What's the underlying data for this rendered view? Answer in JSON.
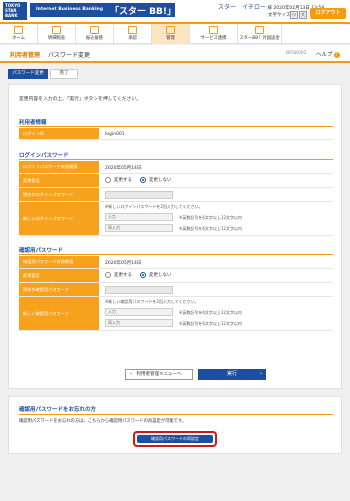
{
  "header": {
    "logo_text": "TOKYO STAR BANK",
    "ibank_text": "Internet Business Banking",
    "ibank_name": "「スター BB!」",
    "user_name": "スター　イチロー",
    "user_suffix": "様",
    "last_login": "2020年02月13日 13:58",
    "font_size_label": "文字サイズ",
    "font_small": "小",
    "font_large": "大",
    "logout_label": "ログアウト"
  },
  "nav": {
    "items": [
      {
        "label": "ホーム"
      },
      {
        "label": "明細照会"
      },
      {
        "label": "振込振替"
      },
      {
        "label": "承認"
      },
      {
        "label": "管理"
      },
      {
        "label": "サービス連携"
      },
      {
        "label": "スターBB！外国送金"
      }
    ],
    "active_index": 4
  },
  "title": {
    "main": "利用者管理",
    "sub": "パスワード変更",
    "screen_id": "BRSK002",
    "help_label": "ヘルプ",
    "help_icon": "?"
  },
  "steps": [
    {
      "label": "パスワード変更"
    },
    {
      "label": "完了"
    }
  ],
  "instruction": "変更内容を入力の上、「実行」ボタンを押してください。",
  "user_info": {
    "title": "利用者情報",
    "login_id_label": "ログインID",
    "login_id_value": "login001"
  },
  "login_password": {
    "title": "ログインパスワード",
    "expiry_label": "ログインパスワード有効期限",
    "expiry_value": "2020年05月14日",
    "change_label": "変更要否",
    "option_change": "変更する",
    "option_nochange": "変更しない",
    "selected": "変更しない",
    "current_label": "現在のログインパスワード",
    "new_label": "新しいログインパスワード",
    "new_hint": "※新しいログインパスワードを2回入力してください。",
    "input_placeholder": "入力",
    "reinput_placeholder": "再入力",
    "note": "※英数記号を6文字以上12文字以内"
  },
  "confirm_password": {
    "title": "確認用パスワード",
    "expiry_label": "確認用パスワード有効期限",
    "expiry_value": "2020年05月14日",
    "change_label": "変更要否",
    "option_change": "変更する",
    "option_nochange": "変更しない",
    "selected": "変更しない",
    "current_label": "現在の確認用パスワード",
    "new_label": "新しい確認用パスワード",
    "new_hint": "※新しい確認用パスワードを2回入力してください。",
    "input_placeholder": "入力",
    "reinput_placeholder": "再入力",
    "note": "※英数記号を6文字以上12文字以内"
  },
  "buttons": {
    "back_label": "利用者管理メニューへ",
    "exec_label": "実行"
  },
  "forgot": {
    "title": "確認用パスワードをお忘れの方",
    "text": "確認用パスワードをお忘れの方は、こちらから確認用パスワードの再設定が可能です。",
    "button_label": "確認用パスワードの再設定"
  }
}
